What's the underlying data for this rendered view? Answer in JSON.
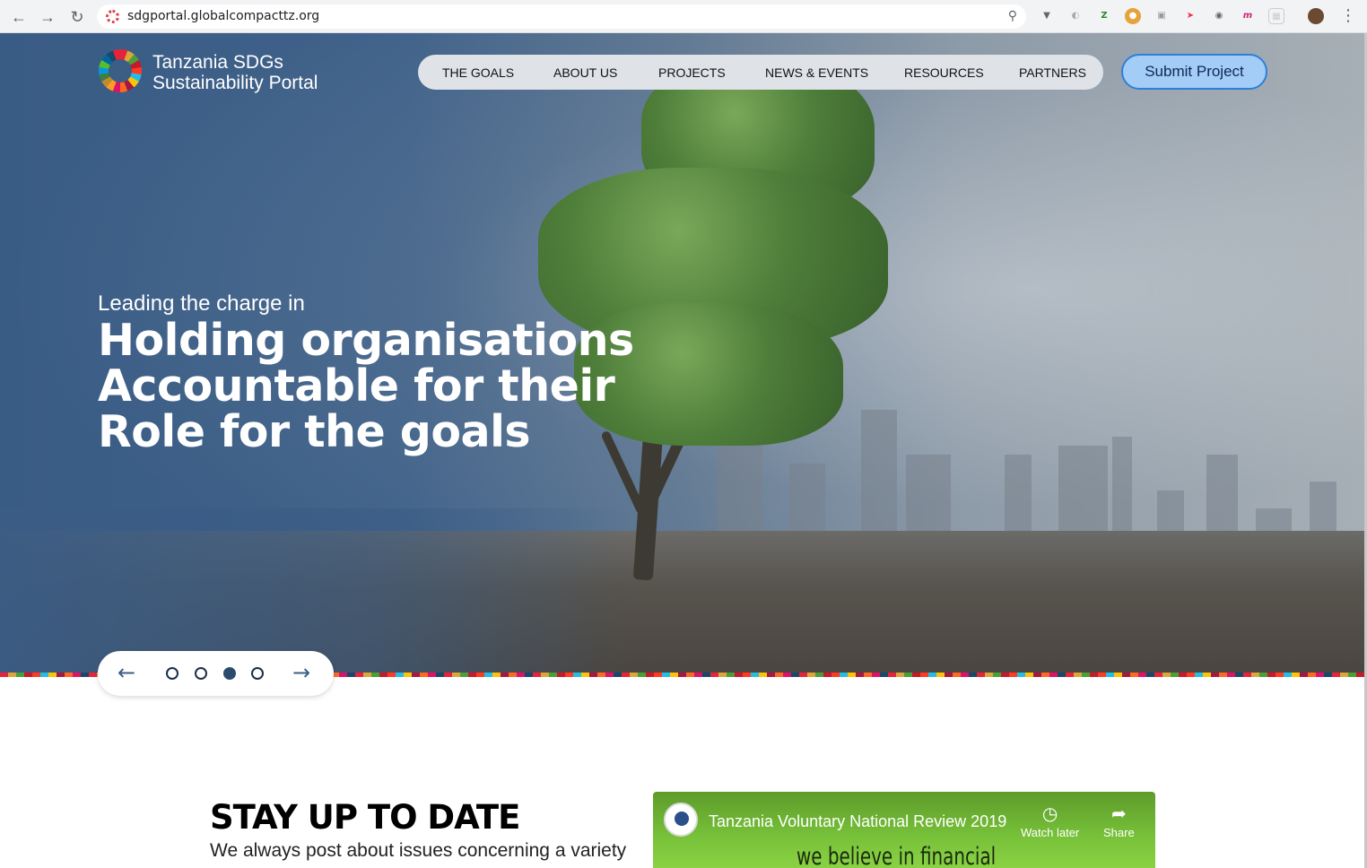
{
  "browser": {
    "url": "sdgportal.globalcompacttz.org",
    "back_icon": "arrow-left-icon",
    "forward_icon": "arrow-right-icon",
    "reload_icon": "reload-icon"
  },
  "header": {
    "logo_line1": "Tanzania SDGs",
    "logo_line2": "Sustainability Portal",
    "nav": [
      "THE GOALS",
      "ABOUT US",
      "PROJECTS",
      "NEWS & EVENTS",
      "RESOURCES",
      "PARTNERS"
    ],
    "cta": "Submit Project"
  },
  "hero": {
    "kicker": "Leading the charge in",
    "title_line1": "Holding organisations",
    "title_line2": "Accountable for their",
    "title_line3": "Role for the goals"
  },
  "carousel": {
    "prev_arrow": "←",
    "next_arrow": "→",
    "slide_count": 4,
    "active_slide": 3
  },
  "section": {
    "title": "STAY UP TO DATE",
    "subtitle": "We always post about issues concerning a variety"
  },
  "video": {
    "title": "Tanzania Voluntary National Review 2019",
    "watch_later": "Watch later",
    "share": "Share",
    "caption": "we believe in financial"
  },
  "colors": {
    "hero_blue": "#3b5d86",
    "cta_fill": "#a3ccf7",
    "cta_border": "#2f7fd8",
    "nav_pill": "#dfe3e8"
  }
}
